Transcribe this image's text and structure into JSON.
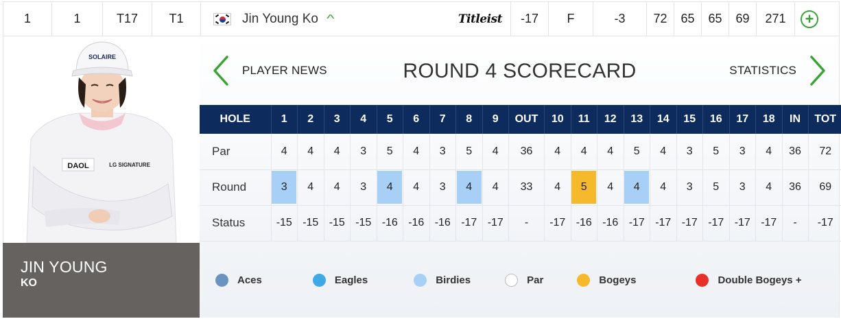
{
  "leaderboard_row": {
    "position": "1",
    "projected": "1",
    "start": "T17",
    "today_pos": "T1",
    "player_name": "Jin Young Ko",
    "country_flag": "south-korea-flag",
    "brand": "Titleist",
    "to_par": "-17",
    "thru": "F",
    "today": "-3",
    "rounds": [
      "72",
      "65",
      "65",
      "69"
    ],
    "total": "271",
    "expand_symbol": "+",
    "collapse_symbol": "^"
  },
  "player_card": {
    "first_name": "JIN YOUNG",
    "last_name": "KO",
    "cap_text": "SOLAIRE",
    "shirt_logo_1": "DAOL",
    "shirt_logo_2": "LG SIGNATURE"
  },
  "scorecard": {
    "nav_left": "PLAYER NEWS",
    "title": "ROUND 4 SCORECARD",
    "nav_right": "STATISTICS",
    "headers": [
      "HOLE",
      "1",
      "2",
      "3",
      "4",
      "5",
      "6",
      "7",
      "8",
      "9",
      "OUT",
      "10",
      "11",
      "12",
      "13",
      "14",
      "15",
      "16",
      "17",
      "18",
      "IN",
      "TOT"
    ],
    "rows": [
      {
        "label": "Par",
        "cells": [
          "4",
          "4",
          "4",
          "3",
          "5",
          "4",
          "3",
          "5",
          "4",
          "36",
          "4",
          "4",
          "4",
          "5",
          "4",
          "3",
          "5",
          "3",
          "4",
          "36",
          "72"
        ],
        "marks": []
      },
      {
        "label": "Round",
        "cells": [
          "3",
          "4",
          "4",
          "3",
          "4",
          "4",
          "3",
          "4",
          "4",
          "33",
          "4",
          "5",
          "4",
          "4",
          "4",
          "3",
          "5",
          "3",
          "4",
          "36",
          "69"
        ],
        "marks": [
          "birdie",
          "",
          "",
          "",
          "birdie",
          "",
          "",
          "birdie",
          "",
          "",
          "",
          "bogey",
          "",
          "birdie",
          "",
          "",
          "",
          "",
          "",
          "",
          ""
        ]
      },
      {
        "label": "Status",
        "cells": [
          "-15",
          "-15",
          "-15",
          "-15",
          "-16",
          "-16",
          "-16",
          "-17",
          "-17",
          "-",
          "-17",
          "-16",
          "-16",
          "-17",
          "-17",
          "-17",
          "-17",
          "-17",
          "-17",
          "-",
          "-17"
        ],
        "marks": []
      }
    ]
  },
  "legend": [
    {
      "label": "Aces",
      "color": "#6b93bf"
    },
    {
      "label": "Eagles",
      "color": "#3fa9e8"
    },
    {
      "label": "Birdies",
      "color": "#a8d0f7"
    },
    {
      "label": "Par",
      "color": "#ffffff"
    },
    {
      "label": "Bogeys",
      "color": "#f6b92b"
    },
    {
      "label": "Double Bogeys +",
      "color": "#e8302a"
    }
  ],
  "colors": {
    "header_navy": "#0d2b5c",
    "accent_green": "#3aa335",
    "name_panel": "#66625f"
  }
}
